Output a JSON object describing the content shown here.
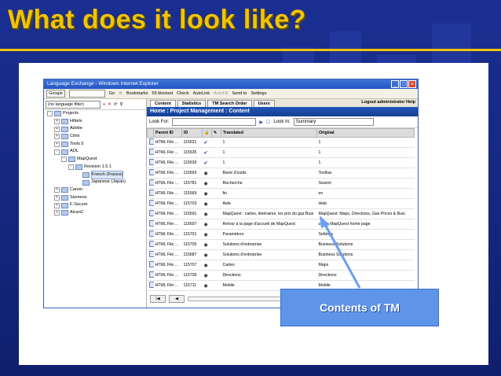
{
  "slide": {
    "title": "What does it look like?",
    "callout": "Contents of TM",
    "colors": {
      "title": "#f2c400",
      "background": "#1b2f92",
      "callout": "#5f95e8"
    }
  },
  "browser": {
    "window_title": "Language Exchange - Windows Internet Explorer",
    "toolbar": {
      "search_engine": "Google",
      "go": "Go",
      "bookmarks": "Bookmarks",
      "blocked": "55 blocked",
      "check": "Check",
      "autolink": "AutoLink",
      "autofill": "AutoFill",
      "send_to": "Send to",
      "settings": "Settings"
    }
  },
  "app": {
    "filter": "(no language filter)",
    "tree": [
      {
        "label": "Projects",
        "depth": 0,
        "toggle": "-"
      },
      {
        "label": "Hôtels",
        "depth": 1,
        "toggle": "+"
      },
      {
        "label": "Adobe",
        "depth": 1,
        "toggle": "+"
      },
      {
        "label": "Citrix",
        "depth": 1,
        "toggle": "+"
      },
      {
        "label": "Tools 5",
        "depth": 1,
        "toggle": "+"
      },
      {
        "label": "AOL",
        "depth": 1,
        "toggle": "-"
      },
      {
        "label": "MapQuest",
        "depth": 2,
        "toggle": "-"
      },
      {
        "label": "Revision 1.5.1",
        "depth": 3,
        "toggle": "-"
      },
      {
        "label": "French (France)",
        "depth": 4,
        "toggle": "",
        "selected": true
      },
      {
        "label": "Japanese (Japan)",
        "depth": 4,
        "toggle": ""
      },
      {
        "label": "Canon",
        "depth": 1,
        "toggle": "+"
      },
      {
        "label": "Siemens",
        "depth": 1,
        "toggle": "+"
      },
      {
        "label": "F-Secure",
        "depth": 1,
        "toggle": "+"
      },
      {
        "label": "AlcanC",
        "depth": 1,
        "toggle": "+"
      }
    ],
    "tabs": [
      "Content",
      "Statistics",
      "TM Search Order",
      "Users"
    ],
    "logout": "Logout administrator",
    "help": "Help",
    "breadcrumb": "Home : Project Management : Content",
    "look_for_label": "Look For:",
    "look_in_label": "Look In:",
    "look_in_value": "Summary",
    "columns": [
      "Parent ID",
      "ID",
      "Translated",
      "Original"
    ],
    "rows": [
      {
        "parent": "HTML File ...",
        "id": "115631",
        "status": "check",
        "translated": "1",
        "original": "1"
      },
      {
        "parent": "HTML File ...",
        "id": "115635",
        "status": "check",
        "translated": "1",
        "original": "1"
      },
      {
        "parent": "HTML File ...",
        "id": "115639",
        "status": "check",
        "translated": "1",
        "original": "1"
      },
      {
        "parent": "HTML File ...",
        "id": "115693",
        "status": "eye",
        "translated": "Barre d'outils",
        "original": "Toolbar"
      },
      {
        "parent": "HTML File ...",
        "id": "115781",
        "status": "eye",
        "translated": "Recherche",
        "original": "Search"
      },
      {
        "parent": "HTML File ...",
        "id": "115569",
        "status": "eye",
        "translated": "fin",
        "original": "en"
      },
      {
        "parent": "HTML File ...",
        "id": "115703",
        "status": "eye",
        "translated": "Aide",
        "original": "Help"
      },
      {
        "parent": "HTML File ...",
        "id": "115691",
        "status": "eye",
        "translated": "MapQuest : cartes, itinéraires, les prix du gaz Busi",
        "original": "MapQuest: Maps, Directions, Gas Prices & Busi"
      },
      {
        "parent": "HTML File ...",
        "id": "115697",
        "status": "eye",
        "translated": "Retour à la page d'accueil de MapQuest",
        "original": "urn to MapQuest home page"
      },
      {
        "parent": "HTML File ...",
        "id": "115701",
        "status": "eye",
        "translated": "Paramètres",
        "original": "Settings"
      },
      {
        "parent": "HTML File ...",
        "id": "115705",
        "status": "eye",
        "translated": "Solutions d'entreprise",
        "original": "Business Solutions"
      },
      {
        "parent": "HTML File ...",
        "id": "115687",
        "status": "eye",
        "translated": "Solutions d'entreprise",
        "original": "Business Solutions"
      },
      {
        "parent": "HTML File ...",
        "id": "115707",
        "status": "eye",
        "translated": "Cartes",
        "original": "Maps"
      },
      {
        "parent": "HTML File ...",
        "id": "115709",
        "status": "eye",
        "translated": "Directions",
        "original": "Directions"
      },
      {
        "parent": "HTML File ...",
        "id": "115711",
        "status": "eye",
        "translated": "Mobile",
        "original": "Mobile"
      }
    ]
  }
}
